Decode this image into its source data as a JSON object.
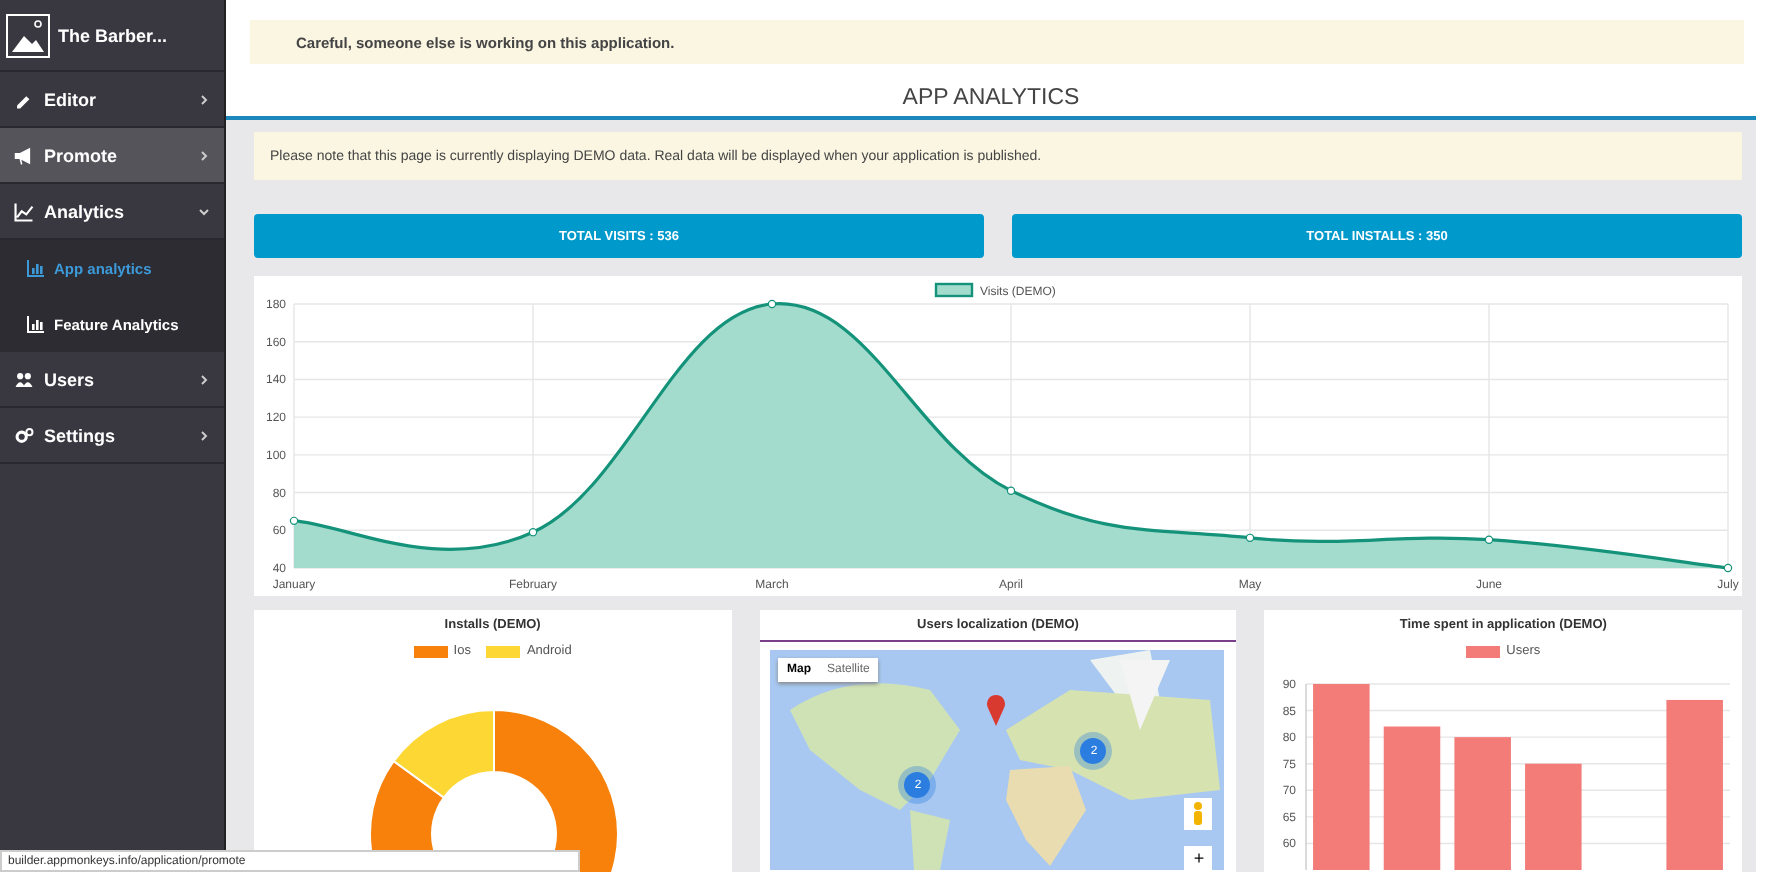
{
  "sidebar": {
    "app_name": "The Barber...",
    "items": [
      {
        "label": "Editor",
        "selected": false,
        "expanded": false
      },
      {
        "label": "Promote",
        "selected": true,
        "expanded": false
      },
      {
        "label": "Analytics",
        "selected": false,
        "expanded": true,
        "children": [
          {
            "label": "App analytics",
            "selected": true
          },
          {
            "label": "Feature Analytics",
            "selected": false
          }
        ]
      },
      {
        "label": "Users",
        "selected": false,
        "expanded": false
      },
      {
        "label": "Settings",
        "selected": false,
        "expanded": false
      }
    ]
  },
  "warning": "Careful, someone else is working on this application.",
  "page_title": "APP ANALYTICS",
  "notice": "Please note that this page is currently displaying DEMO data. Real data will be displayed when your application is published.",
  "totals": [
    "TOTAL VISITS : 536",
    "TOTAL INSTALLS : 350"
  ],
  "visits": {
    "chart_data": {
      "type": "area",
      "categories": [
        "January",
        "February",
        "March",
        "April",
        "May",
        "June",
        "July"
      ],
      "series": [
        {
          "name": "Visits (DEMO)",
          "color": "#14937a",
          "values": [
            65,
            59,
            180,
            81,
            56,
            55,
            40
          ]
        }
      ],
      "ylim": [
        40,
        180
      ],
      "yticks": [
        40,
        60,
        80,
        100,
        120,
        140,
        160,
        180
      ],
      "grid": true
    }
  },
  "installs": {
    "title": "Installs (DEMO)",
    "legend": [
      {
        "label": "Ios",
        "color": "#f7810a"
      },
      {
        "label": "Android",
        "color": "#fdd835"
      }
    ]
  },
  "map": {
    "title": "Users localization (DEMO)",
    "map_types": [
      {
        "label": "Map",
        "selected": true
      },
      {
        "label": "Satellite",
        "selected": false
      }
    ],
    "markers": [
      "2",
      "2"
    ],
    "zoom_in": "+"
  },
  "time_spent": {
    "chart_data": {
      "type": "bar",
      "title": "Time spent in application (DEMO)",
      "series": [
        {
          "name": "Users",
          "color": "#f37b78",
          "values": [
            90,
            82,
            80,
            75,
            null,
            87
          ]
        }
      ],
      "ylim": [
        55,
        90
      ],
      "yticks": [
        60,
        65,
        70,
        75,
        80,
        85,
        90
      ],
      "grid": true
    }
  },
  "status_bar": "builder.appmonkeys.info/application/promote"
}
